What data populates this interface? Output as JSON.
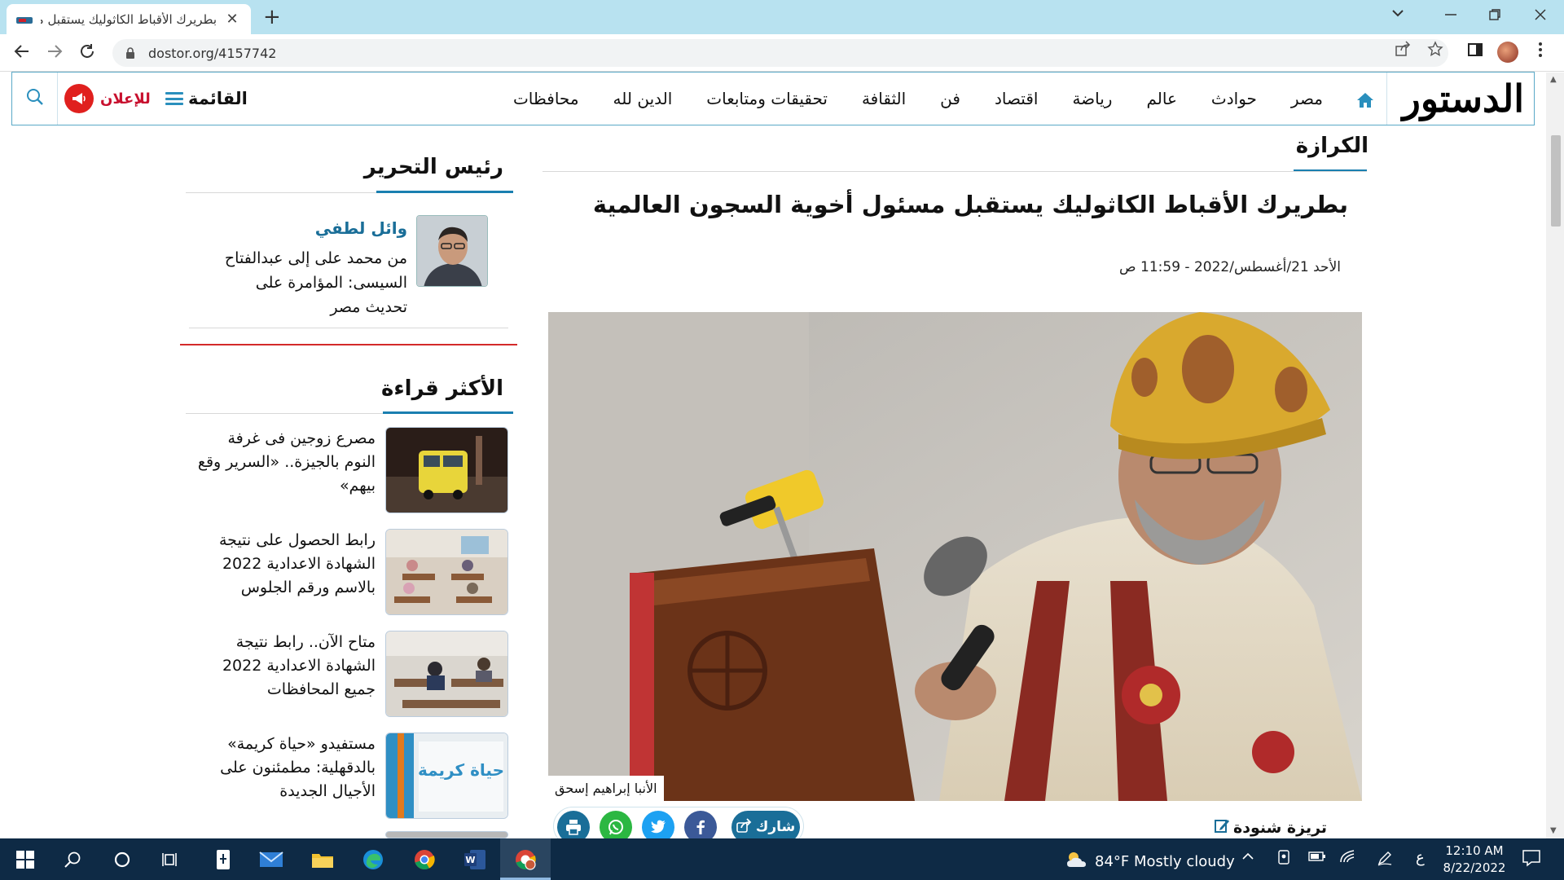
{
  "browser": {
    "tab_title": "بطريرك الأقباط الكاثوليك يستقبل مسئول",
    "tab_close": "✕",
    "new_tab": "+",
    "url": "dostor.org/4157742"
  },
  "site": {
    "logo_main": "الدستور",
    "nav": [
      "مصر",
      "حوادث",
      "عالم",
      "رياضة",
      "اقتصاد",
      "فن",
      "الثقافة",
      "تحقيقات ومتابعات",
      "الدين لله",
      "محافظات"
    ],
    "menu_label": "القائمة",
    "ad_label": "للإعلان"
  },
  "article": {
    "section": "الكرازة",
    "headline": "بطريرك الأقباط الكاثوليك يستقبل مسئول أخوية السجون العالمية",
    "date": "الأحد 21/أغسطس/2022 - 11:59 ص",
    "caption": "الأنبا إبراهيم إسحق",
    "author": "تريزة شنودة",
    "share_label": "شارك"
  },
  "sidebar": {
    "editor_title": "رئيس التحرير",
    "editor_name": "وائل لطفي",
    "editor_text": "من محمد على إلى عبدالفتاح السيسى: المؤامرة على تحديث مصر",
    "most_read_title": "الأكثر قراءة",
    "most_read": [
      "مصرع زوجين فى غرفة النوم بالجيزة.. «السرير وقع بيهم»",
      "رابط الحصول على نتيجة الشهادة الاعدادية 2022 بالاسم ورقم الجلوس",
      "متاح الآن.. رابط نتيجة الشهادة الاعدادية 2022 جميع المحافظات",
      "مستفيدو «حياة كريمة» بالدقهلية: مطمئنون على الأجيال الجديدة"
    ],
    "thumb4_text": "حياة كريمة"
  },
  "taskbar": {
    "weather": "84°F  Mostly cloudy",
    "lang": "ع",
    "time": "12:10 AM",
    "date": "8/22/2022"
  },
  "colors": {
    "accent_blue": "#1a7fb0",
    "logo_red": "#c8102e",
    "chrome_tabbar": "#b8e2f0",
    "taskbar": "#0e2a45"
  }
}
